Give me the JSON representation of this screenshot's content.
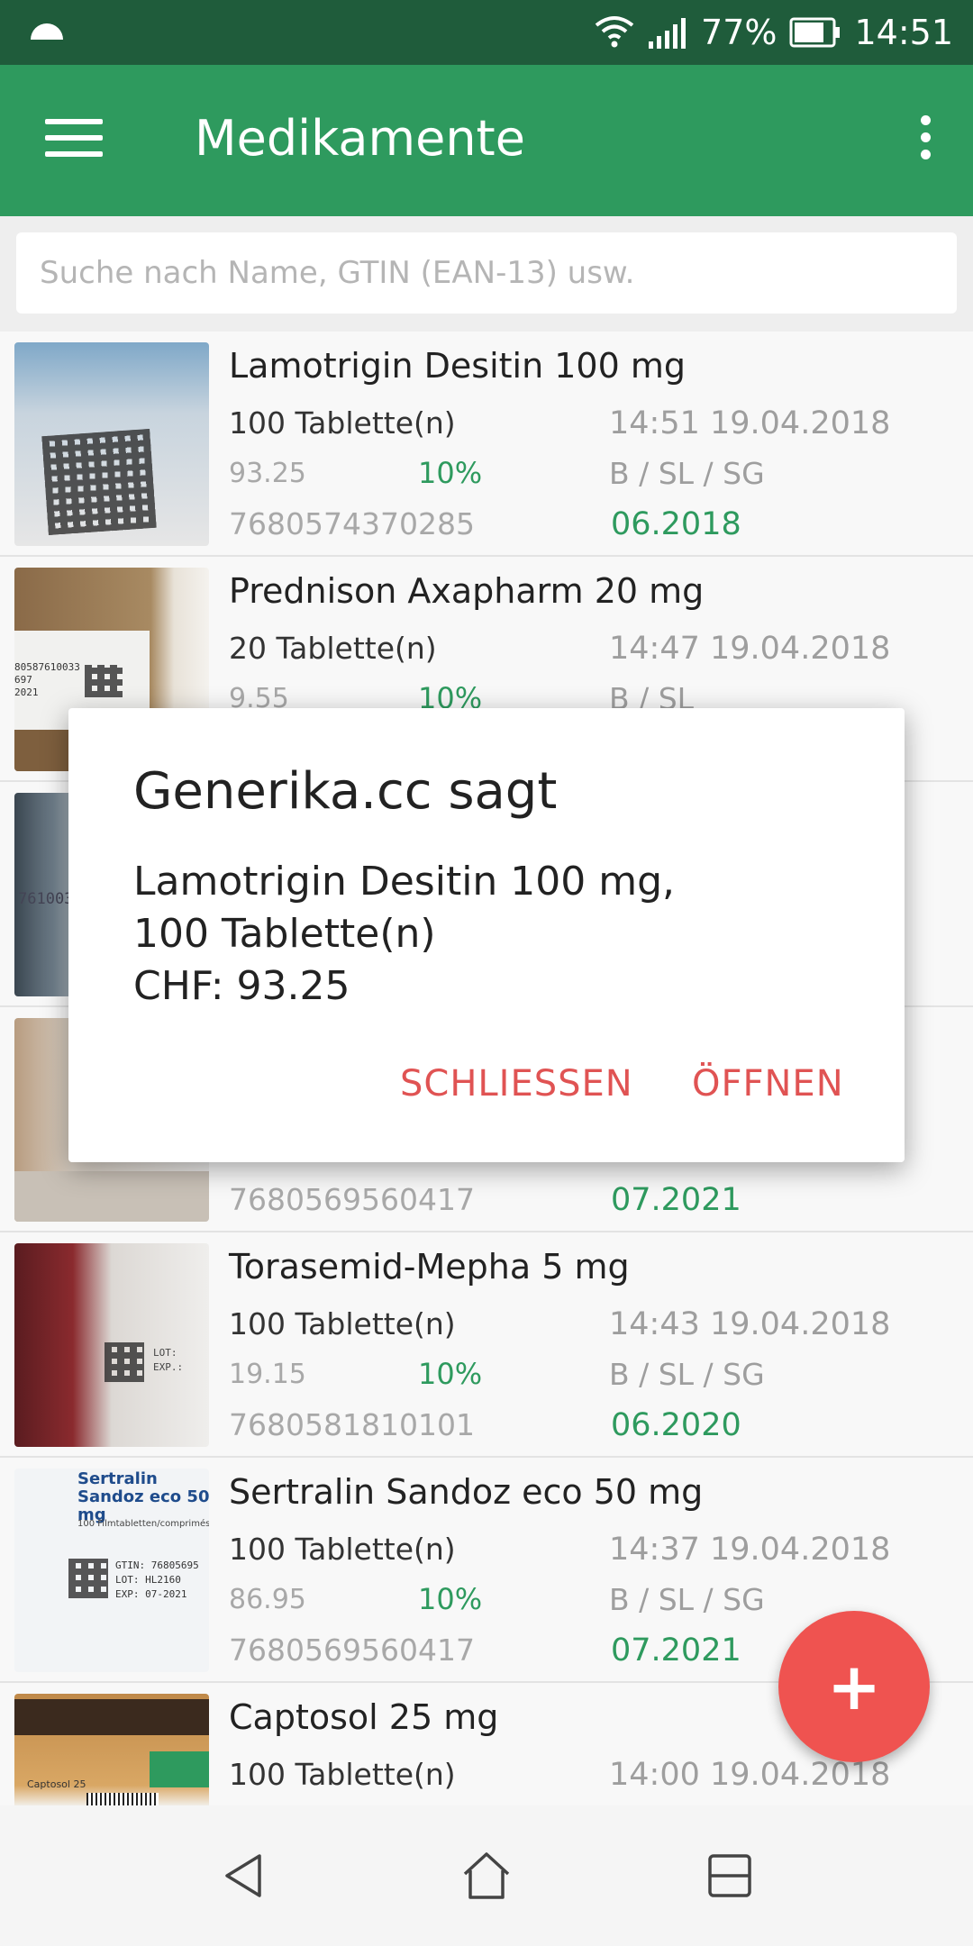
{
  "status_bar": {
    "battery": "77%",
    "time": "14:51",
    "icons": [
      "cloud-icon",
      "wifi-icon",
      "signal-icon",
      "battery-icon"
    ]
  },
  "app_bar": {
    "title": "Medikamente",
    "icons": [
      "menu-icon",
      "overflow-menu-icon"
    ]
  },
  "search": {
    "placeholder": "Suche nach Name, GTIN (EAN-13) usw."
  },
  "list": [
    {
      "name": "Lamotrigin Desitin 100 mg",
      "qty": "100 Tablette(n)",
      "datetime": "14:51 19.04.2018",
      "price": "93.25",
      "pct": "10%",
      "cat": "B / SL / SG",
      "gtin": "7680574370285",
      "exp": "06.2018"
    },
    {
      "name": "Prednison Axapharm 20 mg",
      "qty": "20 Tablette(n)",
      "datetime": "14:47 19.04.2018",
      "price": "9.55",
      "pct": "10%",
      "cat": "B / SL",
      "gtin": "",
      "exp": ""
    },
    {
      "name": "",
      "qty": "",
      "datetime": "",
      "price": "",
      "pct": "",
      "cat": "",
      "gtin": "",
      "exp": ""
    },
    {
      "name": "",
      "qty": "",
      "datetime": "",
      "price": "",
      "pct": "",
      "cat": "",
      "gtin": "7680569560417",
      "exp": "07.2021"
    },
    {
      "name": "Torasemid-Mepha 5 mg",
      "qty": "100 Tablette(n)",
      "datetime": "14:43 19.04.2018",
      "price": "19.15",
      "pct": "10%",
      "cat": "B / SL / SG",
      "gtin": "7680581810101",
      "exp": "06.2020"
    },
    {
      "name": "Sertralin Sandoz eco 50 mg",
      "qty": "100 Tablette(n)",
      "datetime": "14:37 19.04.2018",
      "price": "86.95",
      "pct": "10%",
      "cat": "B / SL / SG",
      "gtin": "7680569560417",
      "exp": "07.2021"
    },
    {
      "name": "Captosol 25 mg",
      "qty": "100 Tablette(n)",
      "datetime": "14:00 19.04.2018",
      "price": "",
      "pct": "",
      "cat": "",
      "gtin": "",
      "exp": ""
    }
  ],
  "thumb_text": {
    "sertralin_title": "Sertralin Sandoz eco 50 mg",
    "sertralin_sub": "100 Filmtabletten/comprimés",
    "sertralin_lines": [
      "GTIN: 76805695",
      "LOT: HL2160",
      "EXP: 07-2021"
    ],
    "torasemid_lines": [
      "LOT:",
      "EXP.:"
    ],
    "captosol_label": "Captosol 25",
    "prednison_lines": [
      "80587610033",
      "697",
      "2021"
    ],
    "row3_code": "761003"
  },
  "dialog": {
    "title": "Generika.cc sagt",
    "line1": "Lamotrigin Desitin 100 mg,",
    "line2": "100 Tablette(n)",
    "line3": "CHF: 93.25",
    "close_label": "SCHLIESSEN",
    "open_label": "ÖFFNEN"
  },
  "fab": {
    "label": "+"
  },
  "colors": {
    "primary": "#2e9a5e",
    "primary_dark": "#1f5c3b",
    "accent": "#ef5350",
    "dialog_button": "#e05353"
  },
  "nav_icons": [
    "back-icon",
    "home-icon",
    "recent-apps-icon"
  ]
}
